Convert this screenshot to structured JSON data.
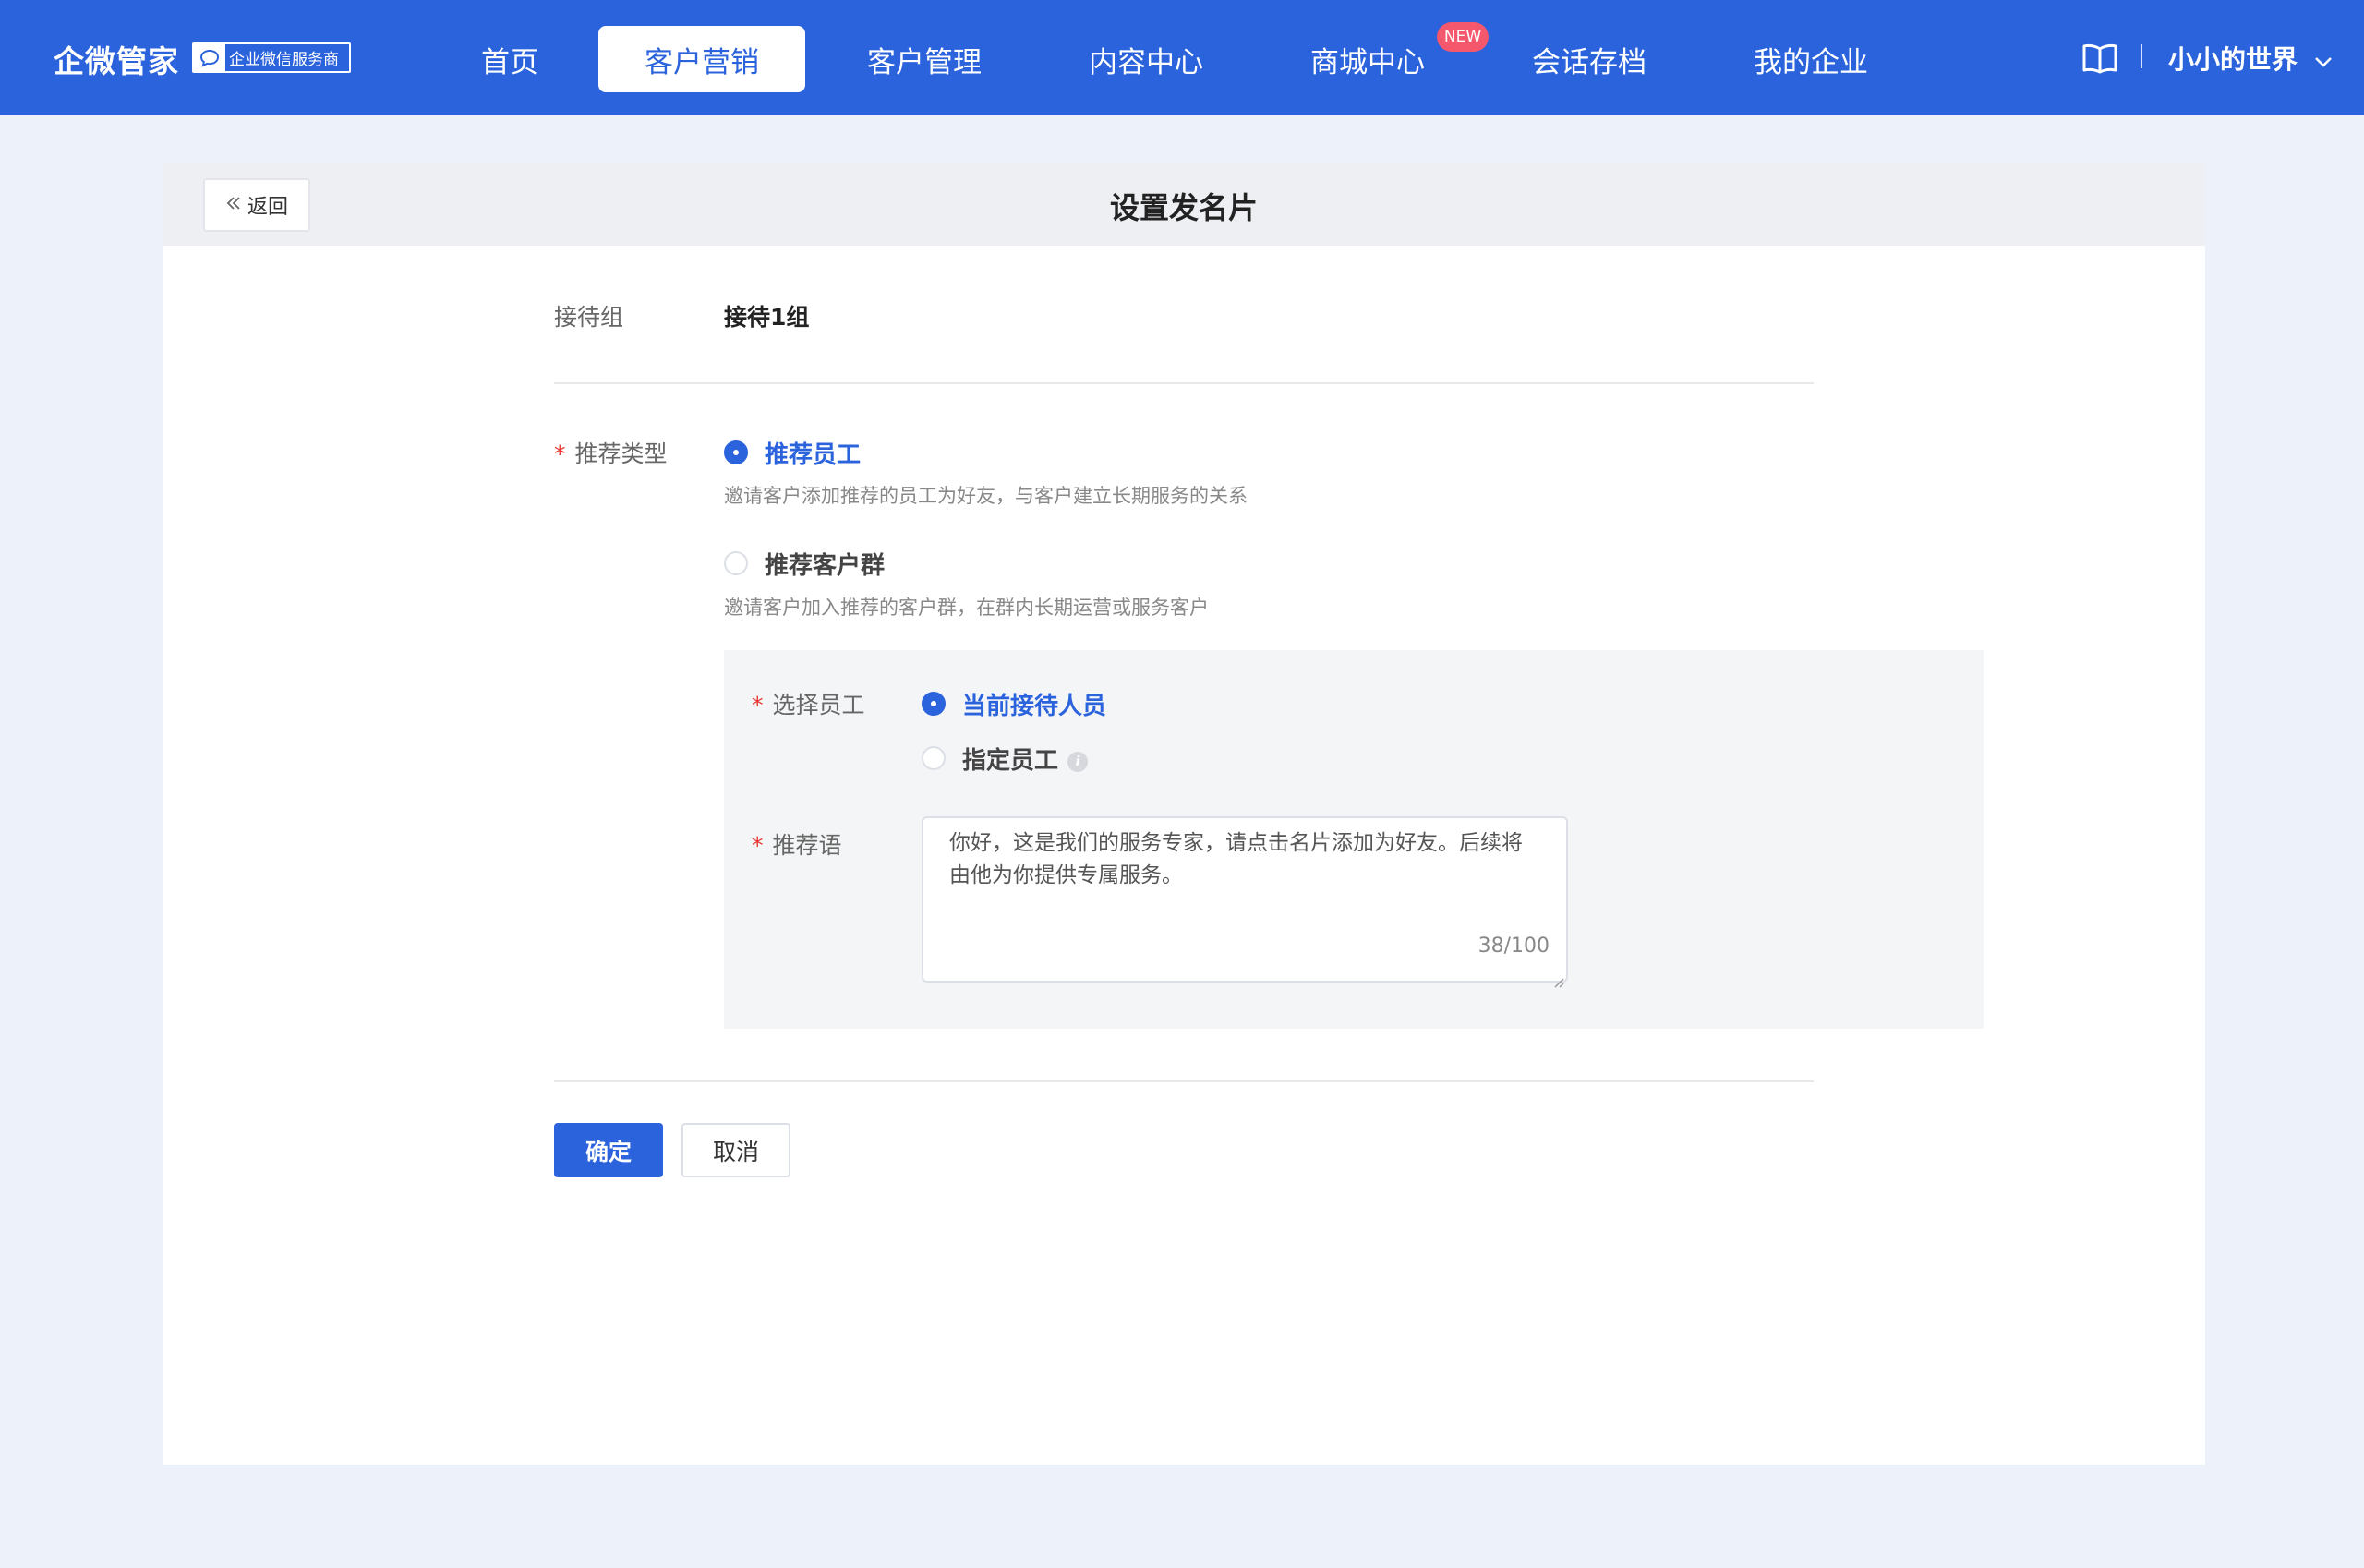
{
  "header": {
    "brand": "企微管家",
    "partner_badge": "企业微信服务商",
    "nav": [
      {
        "label": "首页"
      },
      {
        "label": "客户营销"
      },
      {
        "label": "客户管理"
      },
      {
        "label": "内容中心"
      },
      {
        "label": "商城中心"
      },
      {
        "label": "会话存档"
      },
      {
        "label": "我的企业"
      }
    ],
    "active_nav": "客户营销",
    "new_badge": "NEW",
    "user_name": "小小的世界",
    "icons": [
      "book-icon",
      "chevron-down-icon"
    ]
  },
  "page": {
    "back_label": "返回",
    "title": "设置发名片",
    "reception_group": {
      "label": "接待组",
      "value": "接待1组"
    },
    "recommend_type": {
      "label": "推荐类型",
      "required": "*",
      "options": [
        {
          "label": "推荐员工",
          "desc": "邀请客户添加推荐的员工为好友，与客户建立长期服务的关系",
          "selected": true
        },
        {
          "label": "推荐客户群",
          "desc": "邀请客户加入推荐的客户群，在群内长期运营或服务客户",
          "selected": false
        }
      ]
    },
    "select_staff": {
      "label": "选择员工",
      "required": "*",
      "options": [
        {
          "label": "当前接待人员",
          "selected": true
        },
        {
          "label": "指定员工",
          "selected": false
        }
      ]
    },
    "recommend_text": {
      "label": "推荐语",
      "required": "*",
      "value": "你好，这是我们的服务专家，请点击名片添加为好友。后续将由他为你提供专属服务。",
      "counter": "38/100"
    },
    "confirm_label": "确定",
    "cancel_label": "取消"
  },
  "colors": {
    "primary": "#2b63dc",
    "badge": "#f5576c",
    "required": "#e8362f",
    "background": "#edf1fa"
  }
}
